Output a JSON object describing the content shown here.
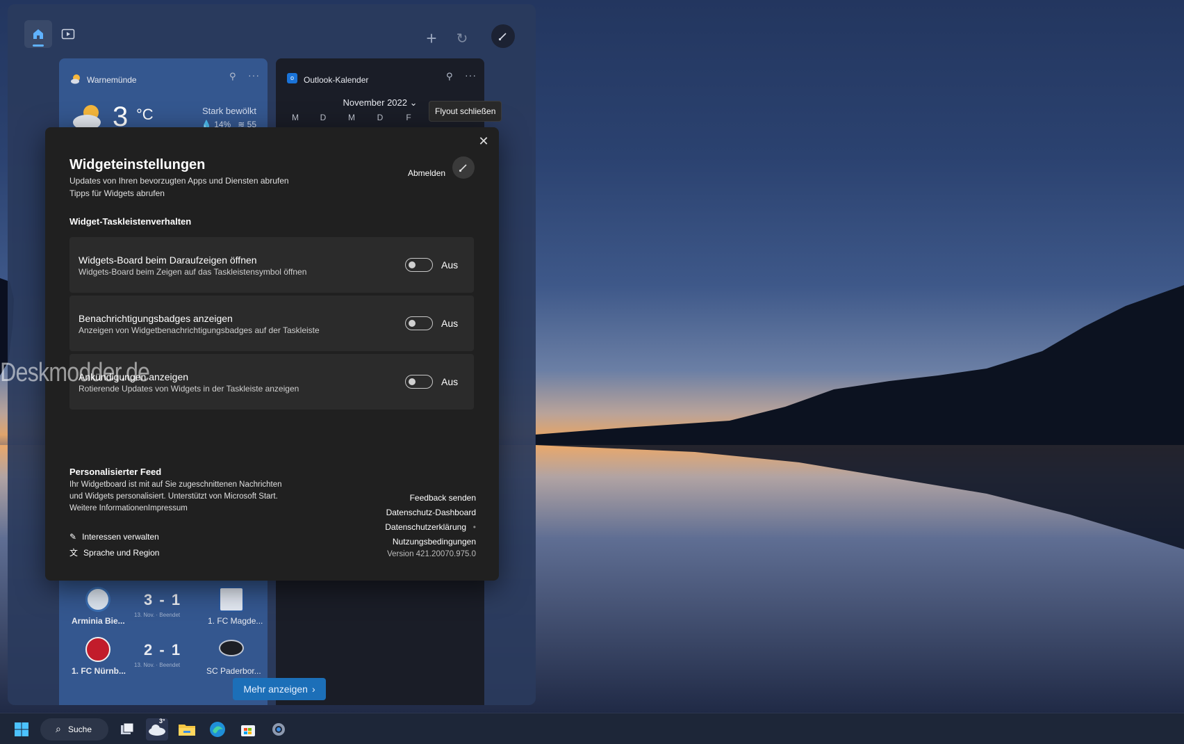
{
  "board": {
    "weather": {
      "location": "Warnemünde",
      "temperature": "3",
      "unit": "°C",
      "condition": "Stark bewölkt",
      "humidity": "14%",
      "wind": "55"
    },
    "calendar": {
      "title": "Outlook-Kalender",
      "month": "November 2022",
      "weekdays": [
        "M",
        "D",
        "M",
        "D",
        "F"
      ]
    },
    "matches": [
      {
        "home": "Arminia Bie...",
        "score_home": "3",
        "score_away": "1",
        "date": "13. Nov. · Beendet",
        "away": "1. FC Magde..."
      },
      {
        "home": "1. FC Nürnb...",
        "score_home": "2",
        "score_away": "1",
        "date": "13. Nov. · Beendet",
        "away": "SC Paderbor..."
      }
    ],
    "more_label": "Mehr anzeigen"
  },
  "tooltip": "Flyout schließen",
  "flyout": {
    "title": "Widgeteinstellungen",
    "subtitle_1": "Updates von Ihren bevorzugten Apps und Diensten abrufen",
    "subtitle_2": "Tipps für Widgets abrufen",
    "signout": "Abmelden",
    "section_title": "Widget-Taskleistenverhalten",
    "settings": [
      {
        "title": "Widgets-Board beim Daraufzeigen öffnen",
        "desc": "Widgets-Board beim Zeigen auf das Taskleistensymbol öffnen",
        "state": "Aus"
      },
      {
        "title": "Benachrichtigungsbadges anzeigen",
        "desc": "Anzeigen von Widgetbenachrichtigungsbadges auf der Taskleiste",
        "state": "Aus"
      },
      {
        "title": "Ankündigungen anzeigen",
        "desc": "Rotierende Updates von Widgets in der Taskleiste anzeigen",
        "state": "Aus"
      }
    ],
    "feed": {
      "title": "Personalisierter Feed",
      "line_1": "Ihr Widgetboard ist mit auf Sie zugeschnittenen Nachrichten",
      "line_2": "und Widgets personalisiert. Unterstützt von Microsoft Start.",
      "line_3": "Weitere InformationenImpressum",
      "manage_interests": "Interessen verwalten",
      "language_region": "Sprache und Region"
    },
    "links": {
      "feedback": "Feedback senden",
      "privacy_dashboard": "Datenschutz-Dashboard",
      "privacy_statement": "Datenschutzerklärung",
      "terms": "Nutzungsbedingungen",
      "version": "Version 421.20070.975.0"
    }
  },
  "watermark": "Deskmodder.de",
  "taskbar": {
    "search_label": "Suche",
    "weather_temp": "3°"
  }
}
